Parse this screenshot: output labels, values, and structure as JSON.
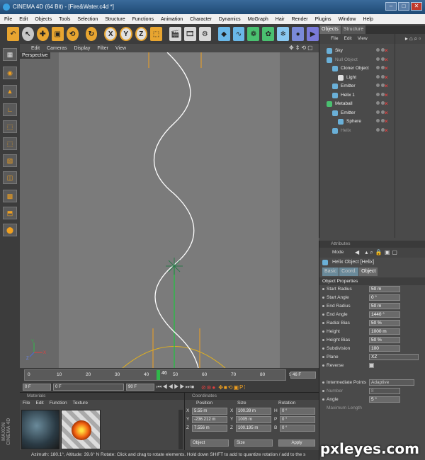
{
  "window": {
    "title": "CINEMA 4D (64 Bit) - [Fire&Water.c4d *]"
  },
  "menubar": [
    "File",
    "Edit",
    "Objects",
    "Tools",
    "Selection",
    "Structure",
    "Functions",
    "Animation",
    "Character",
    "Dynamics",
    "MoGraph",
    "Hair",
    "Render",
    "Plugins",
    "Window",
    "Help"
  ],
  "toolbar": {
    "x_label": "X",
    "y_label": "Y",
    "z_label": "Z"
  },
  "viewport": {
    "menu": [
      "Edit",
      "Cameras",
      "Display",
      "Filter",
      "View"
    ],
    "label": "Perspective"
  },
  "timeline": {
    "ticks": [
      "0",
      "10",
      "20",
      "30",
      "40",
      "50",
      "60",
      "70",
      "80",
      "90"
    ],
    "current_frame": "46",
    "end_field": "46 F",
    "start_field": "0 F",
    "start_field2": "0 F",
    "end_range": "90 F"
  },
  "materials": {
    "title": "Materials",
    "menu": [
      "File",
      "Edit",
      "Function",
      "Texture"
    ]
  },
  "coordinates": {
    "title": "Coordinates",
    "headers": [
      "Position",
      "Size",
      "Rotation"
    ],
    "rows": [
      {
        "axis": "X",
        "pos": "5.55 m",
        "size_axis": "X",
        "size": "100.39 m",
        "rot_axis": "H",
        "rot": "0 °"
      },
      {
        "axis": "Y",
        "pos": "-236.212 m",
        "size_axis": "Y",
        "size": "1005 m",
        "rot_axis": "P",
        "rot": "0 °"
      },
      {
        "axis": "Z",
        "pos": "7.556 m",
        "size_axis": "Z",
        "size": "100.195 m",
        "rot_axis": "B",
        "rot": "0 °"
      }
    ],
    "mode_object": "Object",
    "mode_size": "Size",
    "apply": "Apply"
  },
  "status": {
    "text": "Azimuth: 180.1°, Altitude: 39.6°  N     Rotate: Click and drag to rotate elements. Hold down SHIFT to add to quantize rotation / add to the s"
  },
  "objects": {
    "tabs": [
      "Objects",
      "Structure"
    ],
    "menu": [
      "File",
      "Edit",
      "View"
    ],
    "items": [
      {
        "name": "Sky",
        "indent": 0,
        "dim": false
      },
      {
        "name": "Null Object",
        "indent": 0,
        "dim": true
      },
      {
        "name": "Cloner Object",
        "indent": 1,
        "dim": false
      },
      {
        "name": "Light",
        "indent": 2,
        "dim": false
      },
      {
        "name": "Emitter",
        "indent": 1,
        "dim": false
      },
      {
        "name": "Helix 1",
        "indent": 1,
        "dim": false
      },
      {
        "name": "Metaball",
        "indent": 0,
        "dim": false
      },
      {
        "name": "Emitter",
        "indent": 1,
        "dim": false
      },
      {
        "name": "Sphere",
        "indent": 2,
        "dim": false
      },
      {
        "name": "Helix",
        "indent": 1,
        "dim": true
      }
    ]
  },
  "attributes": {
    "title": "Attributes",
    "mode": "Mode",
    "object_title": "Helix Object [Helix]",
    "tabs": [
      "Basic",
      "Coord.",
      "Object"
    ],
    "section": "Object Properties",
    "props": [
      {
        "label": "Start Radius",
        "value": "50 m"
      },
      {
        "label": "Start Angle",
        "value": "0 °"
      },
      {
        "label": "End Radius",
        "value": "50 m"
      },
      {
        "label": "End Angle",
        "value": "1440 °"
      },
      {
        "label": "Radial Bias",
        "value": "50 %"
      },
      {
        "label": "Height",
        "value": "1000 m"
      },
      {
        "label": "Height Bias",
        "value": "50 %"
      },
      {
        "label": "Subdivision",
        "value": "100"
      },
      {
        "label": "Plane",
        "value": "XZ"
      },
      {
        "label": "Reverse",
        "value": ""
      }
    ],
    "interp_label": "Intermediate Points",
    "interp_value": "Adaptive",
    "number_label": "Number",
    "number_value": "8",
    "angle_label": "Angle",
    "angle_value": "5 °",
    "maxlen_label": "Maximum Length"
  },
  "watermark": "pxleyes.com",
  "colors": {
    "accent": "#f0a020",
    "spline": "#ffffff",
    "guide": "#f0a020",
    "axis_green": "#2fb84a"
  }
}
